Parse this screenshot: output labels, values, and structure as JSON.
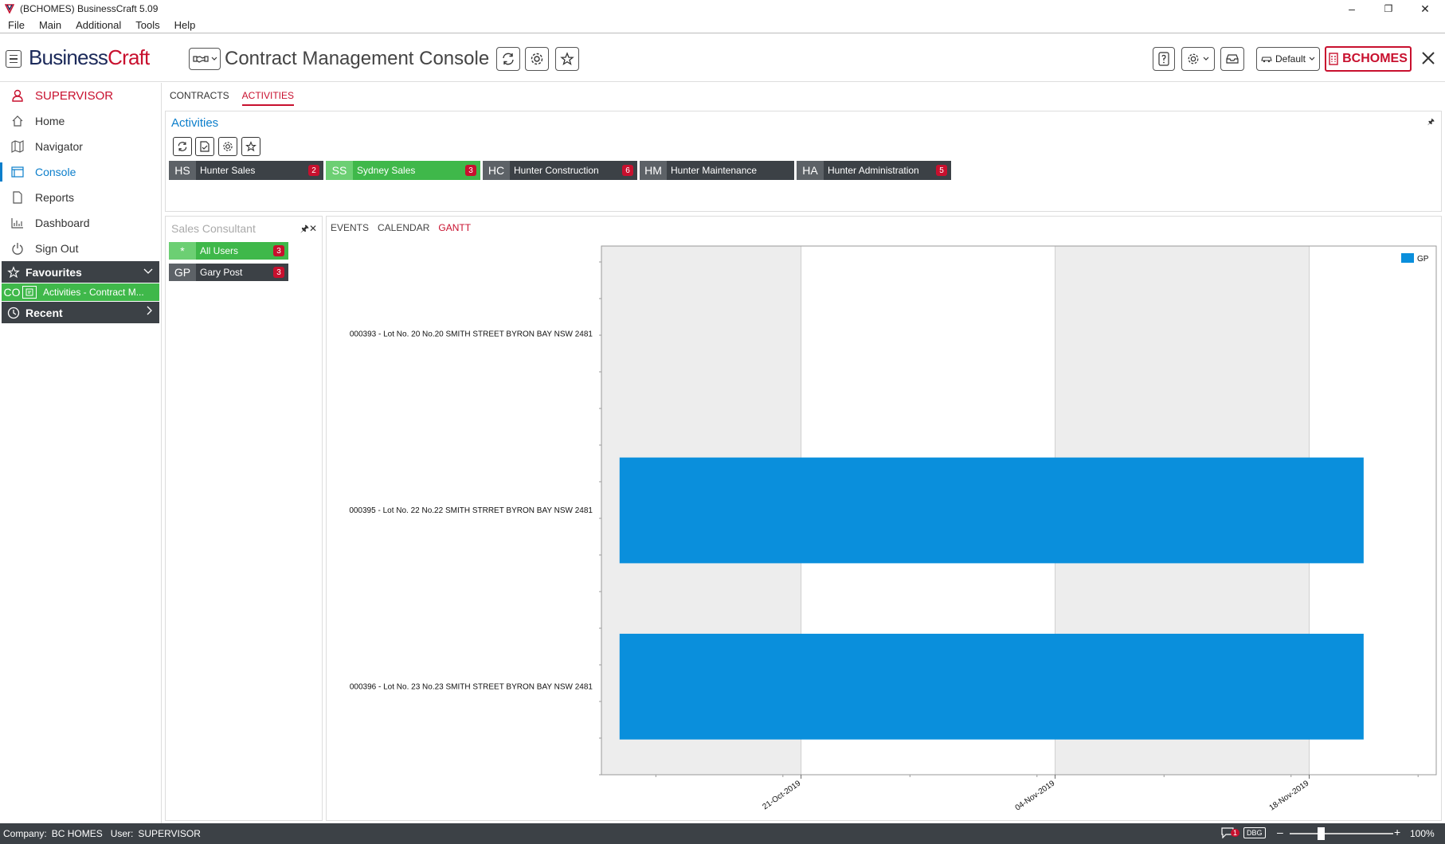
{
  "window": {
    "title": "(BCHOMES) BusinessCraft  5.09",
    "controls": [
      "–",
      "❐",
      "✕"
    ]
  },
  "menu": [
    "File",
    "Main",
    "Additional",
    "Tools",
    "Help"
  ],
  "header": {
    "brand_part1": "Business",
    "brand_part2": "Craft",
    "page_title": "Contract Management Console",
    "layout_label": "Default",
    "company_label": "BCHOMES",
    "colors": {
      "brand_navy": "#1c2a5a",
      "brand_red": "#c8102e",
      "accent_blue": "#0b7ecb"
    }
  },
  "sidebar": {
    "user": "SUPERVISOR",
    "items": [
      {
        "label": "Home",
        "icon": "home-icon"
      },
      {
        "label": "Navigator",
        "icon": "map-icon"
      },
      {
        "label": "Console",
        "icon": "console-icon",
        "active": true
      },
      {
        "label": "Reports",
        "icon": "document-icon"
      },
      {
        "label": "Dashboard",
        "icon": "bar-chart-icon"
      },
      {
        "label": "Sign Out",
        "icon": "power-icon"
      }
    ],
    "favourites_label": "Favourites",
    "favourite_item": {
      "code": "CO",
      "label": "Activities - Contract M..."
    },
    "recent_label": "Recent"
  },
  "tabs": [
    "CONTRACTS",
    "ACTIVITIES"
  ],
  "activities": {
    "title": "Activities",
    "groups": [
      {
        "code": "HS",
        "label": "Hunter Sales",
        "count": "2",
        "style": "dark"
      },
      {
        "code": "SS",
        "label": "Sydney Sales",
        "count": "3",
        "style": "green"
      },
      {
        "code": "HC",
        "label": "Hunter Construction",
        "count": "6",
        "style": "dark"
      },
      {
        "code": "HM",
        "label": "Hunter Maintenance",
        "count": "",
        "style": "dark"
      },
      {
        "code": "HA",
        "label": "Hunter Administration",
        "count": "5",
        "style": "dark"
      }
    ]
  },
  "sales_consultant": {
    "title": "Sales Consultant",
    "users": [
      {
        "code": "*",
        "label": "All Users",
        "count": "3",
        "style": "green"
      },
      {
        "code": "GP",
        "label": "Gary Post",
        "count": "3",
        "style": "dark"
      }
    ]
  },
  "view_tabs": [
    "EVENTS",
    "CALENDAR",
    "GANTT"
  ],
  "chart_data": {
    "type": "gantt",
    "rows": [
      "000393 - Lot No. 20 No.20 SMITH STREET BYRON BAY NSW 2481",
      "000395 - Lot No. 22 No.22 SMITH STRRET BYRON BAY NSW 2481",
      "000396 - Lot No. 23 No.23 SMITH STREET BYRON BAY NSW 2481"
    ],
    "x_ticks": [
      "21-Oct-2019",
      "04-Nov-2019",
      "18-Nov-2019"
    ],
    "x_range": [
      "2019-10-10",
      "2019-11-25"
    ],
    "series": [
      {
        "name": "GP",
        "color": "#0a8fdc",
        "bars": [
          {
            "row": 1,
            "start": "2019-10-11",
            "end": "2019-11-21"
          },
          {
            "row": 2,
            "start": "2019-10-11",
            "end": "2019-11-21"
          }
        ]
      }
    ],
    "legend": "top-right",
    "band_colors": [
      "#ededed",
      "#ffffff"
    ]
  },
  "status": {
    "company_label": "Company:",
    "company_value": "BC HOMES",
    "user_label": "User:",
    "user_value": "SUPERVISOR",
    "notif_count": "1",
    "dbg_label": "DBG",
    "zoom": "100%"
  }
}
